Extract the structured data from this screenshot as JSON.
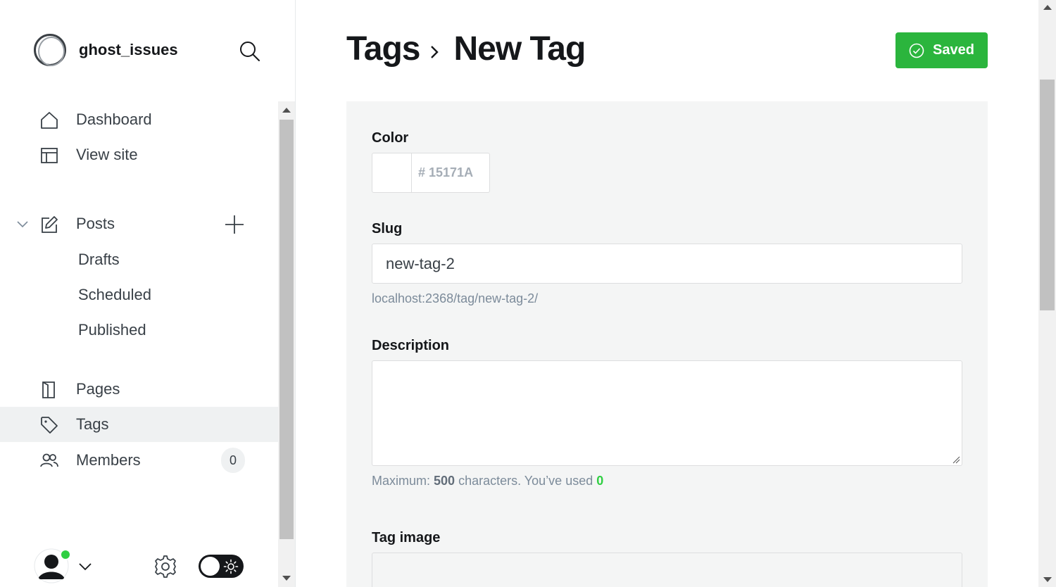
{
  "sidebar": {
    "site_name": "ghost_issues",
    "nav": {
      "dashboard": "Dashboard",
      "view_site": "View site",
      "posts": "Posts",
      "drafts": "Drafts",
      "scheduled": "Scheduled",
      "published": "Published",
      "pages": "Pages",
      "tags": "Tags",
      "members": "Members",
      "members_count": "0"
    },
    "active_item": "Tags",
    "icons": [
      "search-icon",
      "home-icon",
      "view-site-icon",
      "chevron-down-icon",
      "edit-icon",
      "plus-icon",
      "page-icon",
      "tag-icon",
      "members-icon",
      "gear-icon",
      "sun-icon"
    ]
  },
  "header": {
    "breadcrumb_parent": "Tags",
    "title": "New Tag",
    "saved_label": "Saved",
    "saved_color": "#30cf43"
  },
  "form": {
    "color_label": "Color",
    "color_placeholder": "# 15171A",
    "slug_label": "Slug",
    "slug_value": "new-tag-2",
    "slug_url": "localhost:2368/tag/new-tag-2/",
    "description_label": "Description",
    "description_value": "",
    "description_hint_prefix": "Maximum:",
    "description_max": "500",
    "description_hint_middle": "characters. You’ve used",
    "description_used": "0",
    "image_label": "Tag image"
  }
}
